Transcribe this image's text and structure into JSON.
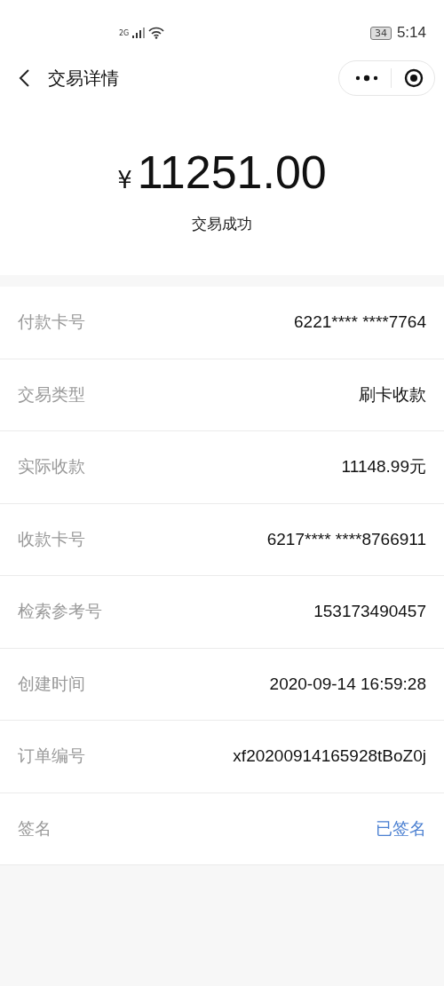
{
  "status_bar": {
    "network": "2G",
    "battery": "34",
    "time": "5:14"
  },
  "nav": {
    "title": "交易详情"
  },
  "summary": {
    "currency": "¥",
    "amount": "11251.00",
    "status": "交易成功"
  },
  "rows": [
    {
      "label": "付款卡号",
      "value": "6221**** ****7764",
      "kind": "text"
    },
    {
      "label": "交易类型",
      "value": "刷卡收款",
      "kind": "text"
    },
    {
      "label": "实际收款",
      "value": "11148.99元",
      "kind": "text"
    },
    {
      "label": "收款卡号",
      "value": "6217**** ****8766911",
      "kind": "text"
    },
    {
      "label": "检索参考号",
      "value": "153173490457",
      "kind": "text"
    },
    {
      "label": "创建时间",
      "value": "2020-09-14 16:59:28",
      "kind": "text"
    },
    {
      "label": "订单编号",
      "value": "xf20200914165928tBoZ0j",
      "kind": "text"
    },
    {
      "label": "签名",
      "value": "已签名",
      "kind": "link"
    }
  ]
}
